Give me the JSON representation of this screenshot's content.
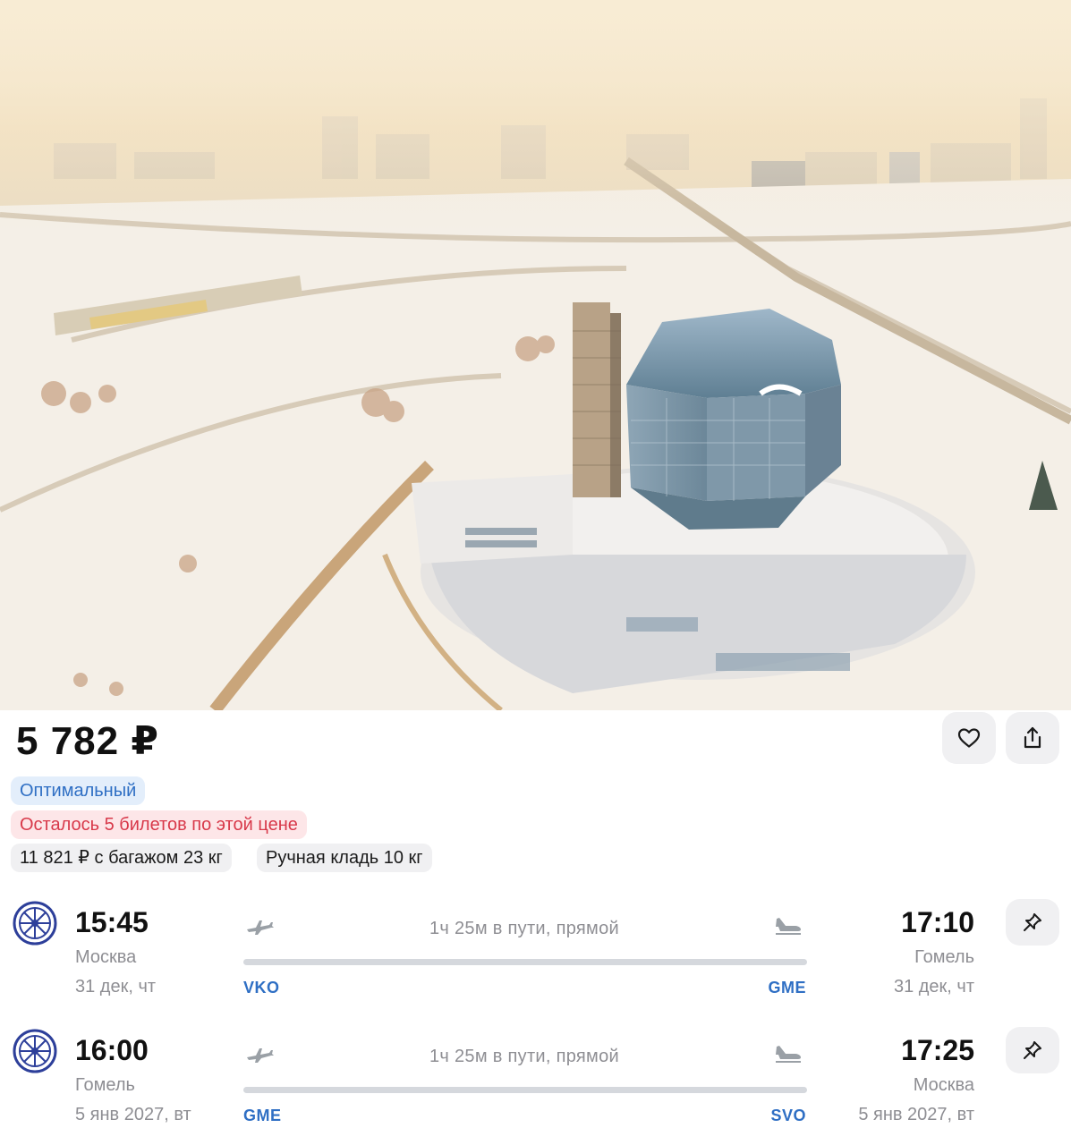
{
  "offer": {
    "price": "5 782 ₽",
    "badge_label": "Оптимальный",
    "tickets_left": "Осталось 5 билетов по этой цене",
    "baggage_option": "11 821 ₽ с багажом 23 кг",
    "hand_luggage": "Ручная кладь 10 кг"
  },
  "icons": {
    "favorite": "heart-icon",
    "share": "share-icon",
    "pin": "pin-icon",
    "takeoff": "plane-takeoff-icon",
    "landing": "plane-landing-icon",
    "airline": "airline-logo-icon"
  },
  "colors": {
    "accent_blue": "#2f6fc4",
    "badge_blue_bg": "#e3eefb",
    "alert_red": "#d8394a",
    "alert_red_bg": "#fde6e8",
    "chip_gray_bg": "#f0f0f2",
    "muted_text": "#8e8e93",
    "airline_logo_blue": "#2d3f9a"
  },
  "flights": [
    {
      "departure_time": "15:45",
      "departure_city": "Москва",
      "departure_date": "31 дек, чт",
      "departure_code": "VKO",
      "duration": "1ч 25м в пути, прямой",
      "arrival_time": "17:10",
      "arrival_city": "Гомель",
      "arrival_date": "31 дек, чт",
      "arrival_code": "GME"
    },
    {
      "departure_time": "16:00",
      "departure_city": "Гомель",
      "departure_date": "5 янв 2027, вт",
      "departure_code": "GME",
      "duration": "1ч 25м в пути, прямой",
      "arrival_time": "17:25",
      "arrival_city": "Москва",
      "arrival_date": "5 янв 2027, вт",
      "arrival_code": "SVO"
    }
  ]
}
